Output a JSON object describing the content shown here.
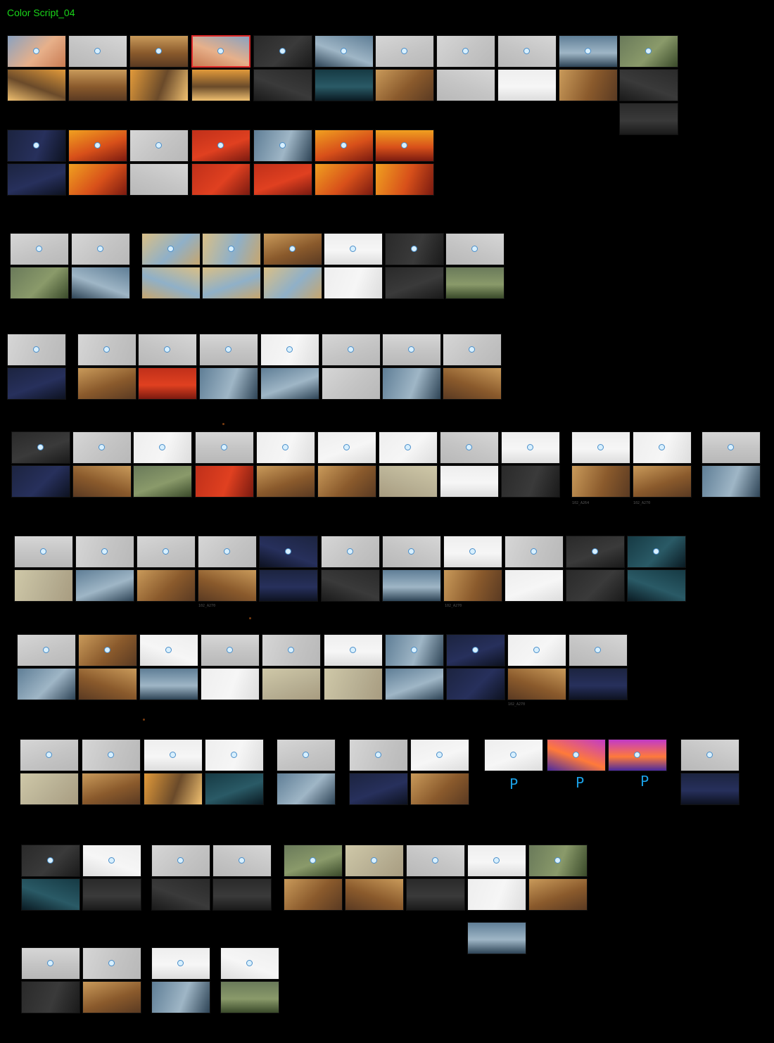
{
  "title": "Color Script_04",
  "captions": [
    "102_A264",
    "102_A270",
    "102_A270",
    "102_A270",
    "102_A270"
  ],
  "marks": [
    "P",
    "P",
    "P"
  ],
  "palette": {
    "sketch": [
      "#d6d6d6",
      "#c4c4c4",
      "#b8b8b8",
      "#e2e2e2",
      "#a9a9a9",
      "#cfcfcf"
    ],
    "sky": [
      "#8aa2c0",
      "#e7b08a",
      "#c97b52"
    ],
    "fire": [
      "#f0a020",
      "#d8501a",
      "#7a1a10"
    ],
    "warm": [
      "#c99a5a",
      "#8a5a2c",
      "#5a3a22"
    ],
    "night": [
      "#1c2440",
      "#27305c",
      "#0d1220"
    ],
    "desert": [
      "#d9bf86",
      "#8fb0c8",
      "#c7a66e"
    ],
    "cool": [
      "#5f7e96",
      "#9fb6c6",
      "#2e4456"
    ],
    "neon": [
      "#c23ac8",
      "#ff7a3a",
      "#4a2aa0"
    ],
    "teal": [
      "#163a44",
      "#2a5a66",
      "#0a1a22"
    ],
    "sunset": [
      "#e29a3a",
      "#6a4a2a",
      "#f0c070"
    ],
    "green": [
      "#6a7a5a",
      "#8a9a6a",
      "#3a4a2a"
    ],
    "beige": [
      "#cfc8a8",
      "#b8b094",
      "#a89c80"
    ],
    "red": [
      "#c0301a",
      "#e04020",
      "#7a1a10"
    ],
    "white": [
      "#eeeeee",
      "#f6f6f6",
      "#dddddd"
    ],
    "dark": [
      "#2a2a2a",
      "#3a3a3a",
      "#1a1a1a"
    ],
    "accent_selected": "#e02a2a",
    "accent_title": "#19d419",
    "accent_mark": "#1aa0e6"
  }
}
